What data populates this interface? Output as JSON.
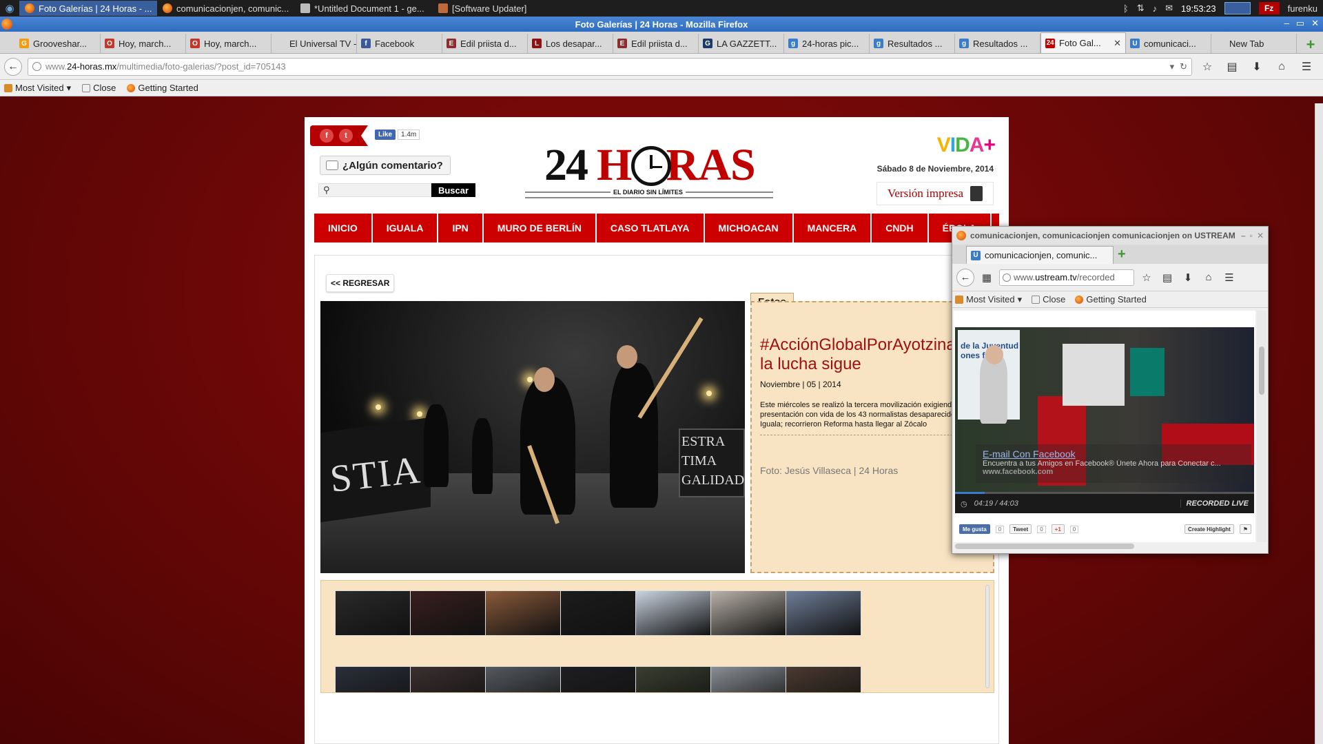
{
  "taskbar": {
    "tasks": [
      {
        "label": "Foto Galerías | 24 Horas - ..."
      },
      {
        "label": "comunicacionjen, comunic..."
      },
      {
        "label": "*Untitled Document 1 - ge..."
      },
      {
        "label": "[Software Updater]"
      }
    ],
    "clock": "19:53:23",
    "user": "furenku"
  },
  "window": {
    "title": "Foto Galerías | 24 Horas - Mozilla Firefox"
  },
  "tabs": [
    {
      "label": "Grooveshar...",
      "icon": "grooveshark-icon",
      "color": "#f39c12",
      "glyph": "G"
    },
    {
      "label": "Hoy, march...",
      "icon": "opera-red-icon",
      "color": "#c0392b",
      "glyph": "O"
    },
    {
      "label": "Hoy, march...",
      "icon": "opera-red-icon",
      "color": "#c0392b",
      "glyph": "O"
    },
    {
      "label": "El Universal TV -...",
      "icon": "blank-icon",
      "color": "#d8d8d8",
      "glyph": ""
    },
    {
      "label": "Facebook",
      "icon": "facebook-icon",
      "color": "#3b5998",
      "glyph": "f"
    },
    {
      "label": "Edil priista d...",
      "icon": "news-icon",
      "color": "#8e2d2d",
      "glyph": "E"
    },
    {
      "label": "Los desapar...",
      "icon": "news-icon",
      "color": "#8e1111",
      "glyph": "L"
    },
    {
      "label": "Edil priista d...",
      "icon": "news-icon",
      "color": "#8e2d2d",
      "glyph": "E"
    },
    {
      "label": "LA GAZZETT...",
      "icon": "gazzetta-icon",
      "color": "#1b3a6b",
      "glyph": "G"
    },
    {
      "label": "24-horas pic...",
      "icon": "google-icon",
      "color": "#3b7cc9",
      "glyph": "g"
    },
    {
      "label": "Resultados ...",
      "icon": "google-icon",
      "color": "#3b7cc9",
      "glyph": "g"
    },
    {
      "label": "Resultados ...",
      "icon": "google-icon",
      "color": "#3b7cc9",
      "glyph": "g"
    },
    {
      "label": "Foto Gal...",
      "icon": "24horas-icon",
      "color": "#c00000",
      "glyph": "24",
      "active": true
    },
    {
      "label": "comunicaci...",
      "icon": "ustream-icon",
      "color": "#3b7cc9",
      "glyph": "U"
    },
    {
      "label": "New Tab",
      "icon": "blank-icon",
      "color": "#d8d8d8",
      "glyph": ""
    }
  ],
  "nav": {
    "url_prefix": "www.",
    "url_host": "24-horas.mx",
    "url_path": "/multimedia/foto-galerias/?post_id=705143"
  },
  "bookmarks": {
    "most_visited": "Most Visited",
    "close": "Close",
    "getting_started": "Getting Started"
  },
  "site": {
    "like_label": "Like",
    "like_count": "1.4m",
    "comment_label": "¿Algún comentario?",
    "search_button": "Buscar",
    "logo_number": "24",
    "logo_word": "HORAS",
    "logo_tagline": "EL DIARIO SIN LÍMITES",
    "vida": "VIDA+",
    "date": "Sábado 8 de Noviembre, 2014",
    "print_version": "Versión impresa",
    "menu": [
      "INICIO",
      "IGUALA",
      "IPN",
      "MURO DE BERLÍN",
      "CASO TLATLAYA",
      "MICHOACAN",
      "MANCERA",
      "CNDH",
      "ÉBOLA"
    ],
    "back_button": "<< REGRESAR",
    "photo_banner_text": "STIA",
    "photo_sign_text": "ESTRA\nTIMA\nGALIDAD",
    "gallery": {
      "tab_label": "Fotos",
      "title": "#AcciónGlobalPorAyotzinapa, la lucha sigue",
      "date": "Noviembre | 05 | 2014",
      "description": "Este miércoles se realizó la tercera movilización exigiendo la presentación con vida de los 43 normalistas desaparecidos en Iguala; recorrieron Reforma hasta llegar al Zócalo",
      "credit": "Foto: Jesús Villaseca | 24 Horas"
    }
  },
  "popup": {
    "title": "comunicacionjen, comunicacionjen comunicacionjen on USTREAM",
    "tab_label": "comunicacionjen, comunic...",
    "url_prefix": "www.",
    "url_host": "ustream.tv",
    "url_path": "/recorded",
    "most_visited": "Most Visited",
    "close": "Close",
    "getting_started": "Getting Started",
    "video_sign_text": "de la Juventud\nones futu",
    "ad_title": "E-mail Con Facebook",
    "ad_text": "Encuentra a tus Amigos en Facebook® Únete Ahora para Conectar c...",
    "ad_url": "www.facebook.com",
    "time": "04:19 / 44:03",
    "progress": 0.098,
    "recorded_live": "RECORDED LIVE",
    "share": {
      "fb": "Me gusta",
      "fb_count": "0",
      "tweet": "Tweet",
      "tweet_count": "0",
      "gplus": "+1",
      "gplus_count": "0",
      "create_highlight": "Create Highlight"
    }
  }
}
